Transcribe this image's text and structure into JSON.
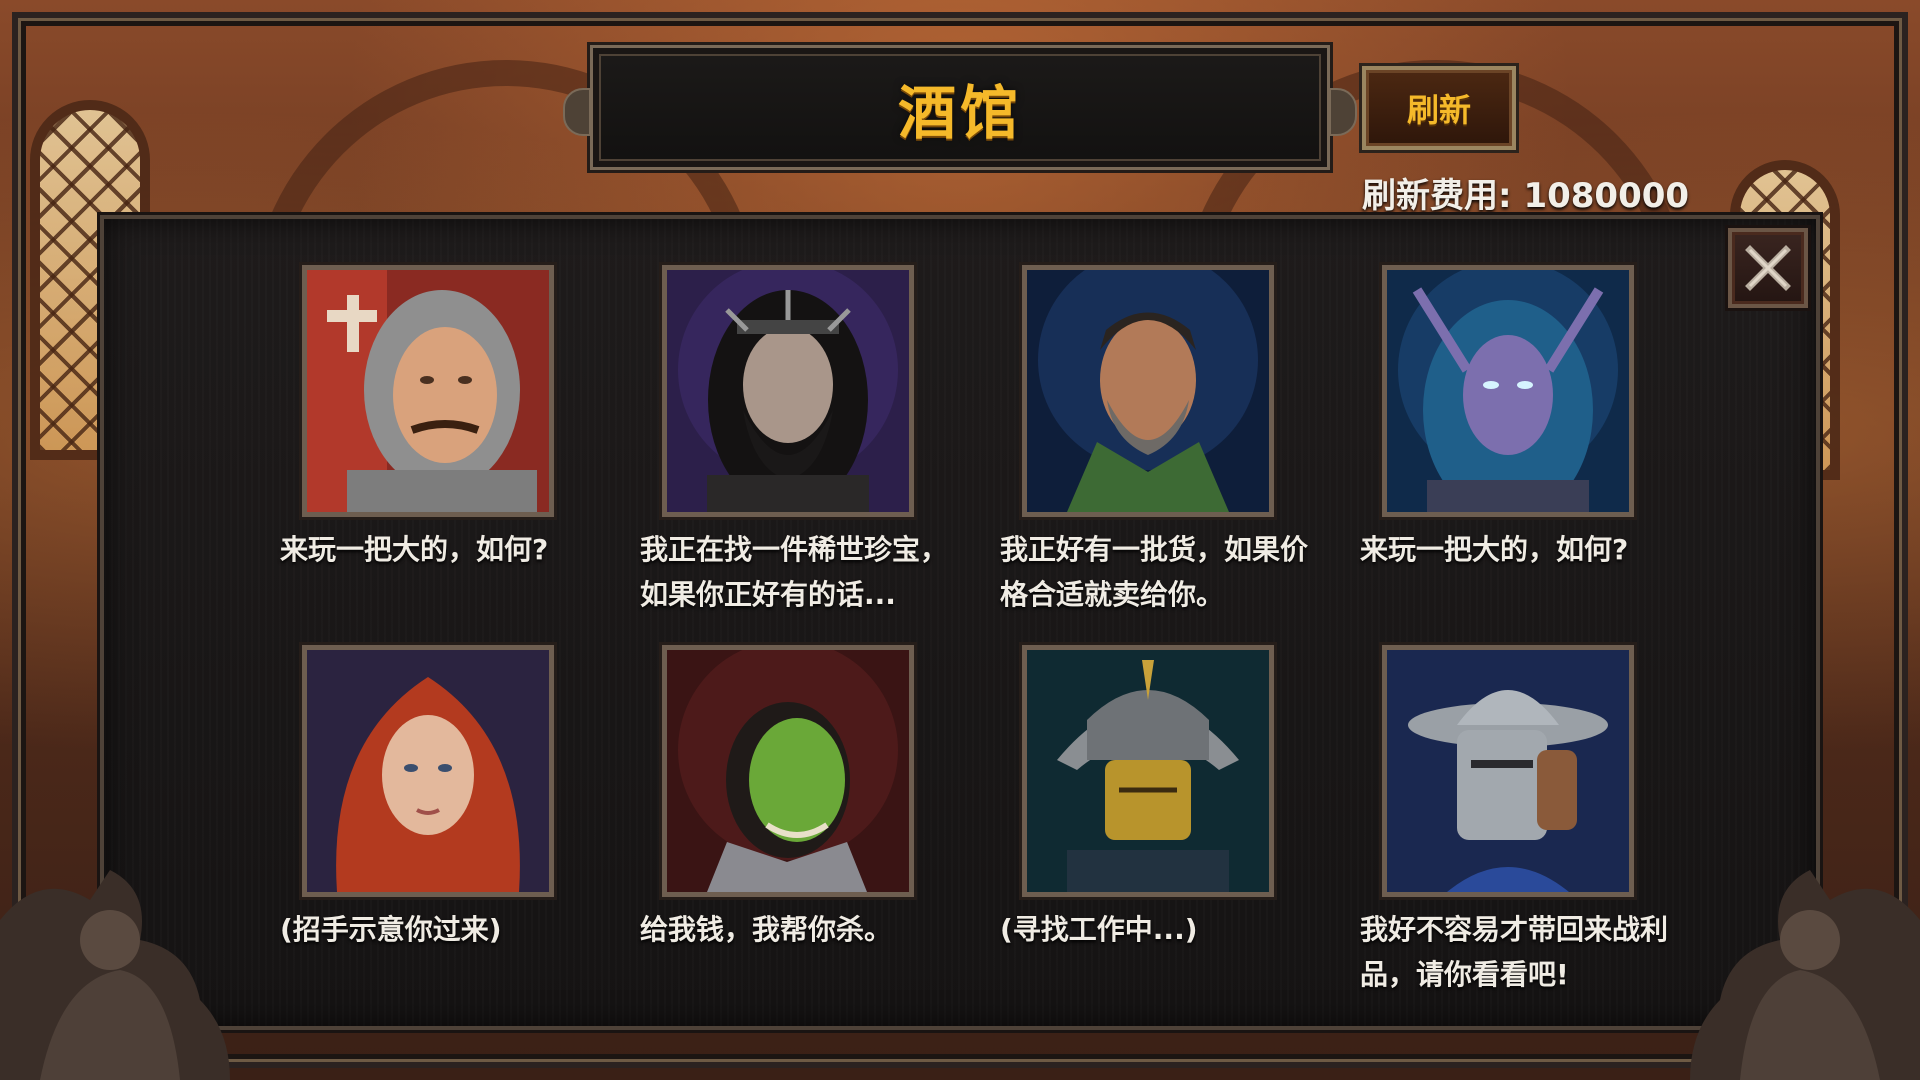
{
  "title": "酒馆",
  "refresh_button": "刷新",
  "refresh_cost": {
    "label": "刷新费用: ",
    "value": "1080000"
  },
  "heroes": [
    {
      "quote": "来玩一把大的，如何?",
      "portrait": "chainmail-knight-portrait"
    },
    {
      "quote": "我正在找一件稀世珍宝，如果你正好有的话...",
      "portrait": "dark-bearded-warrior-portrait"
    },
    {
      "quote": "我正好有一批货，如果价格合适就卖给你。",
      "portrait": "bearded-merchant-portrait"
    },
    {
      "quote": "来玩一把大的，如何?",
      "portrait": "night-elf-portrait"
    },
    {
      "quote": "(招手示意你过来)",
      "portrait": "red-hooded-woman-portrait"
    },
    {
      "quote": "给我钱，我帮你杀。",
      "portrait": "orc-mercenary-portrait"
    },
    {
      "quote": "(寻找工作中...)",
      "portrait": "samurai-portrait"
    },
    {
      "quote": "我好不容易才带回来战利品，请你看看吧!",
      "portrait": "helmeted-soldier-portrait"
    }
  ],
  "colors": {
    "title": "#f5b92a",
    "text": "#f0ece4",
    "panel": "#1b1818"
  },
  "icons": {
    "close": "close-icon"
  }
}
